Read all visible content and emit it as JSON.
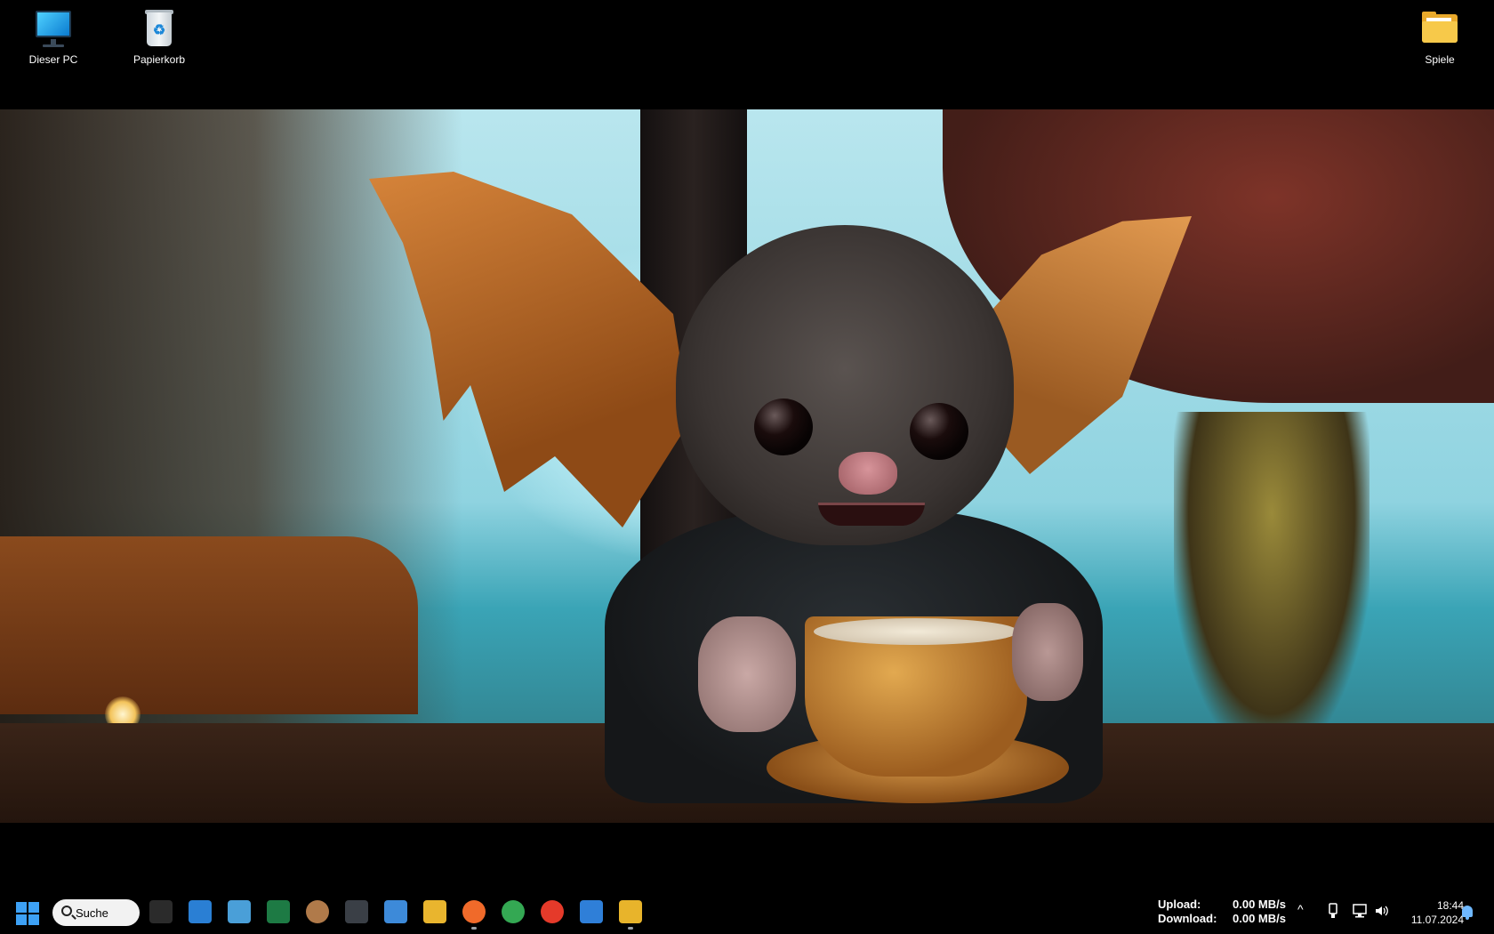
{
  "desktop": {
    "icons": [
      {
        "label": "Dieser PC",
        "icon": "monitor-icon"
      },
      {
        "label": "Papierkorb",
        "icon": "recycle-bin-icon"
      },
      {
        "label": "Spiele",
        "icon": "folder-icon"
      }
    ]
  },
  "wallpaper": {
    "subject": "bat-with-coffee-cup"
  },
  "taskbar": {
    "search_label": "Suche",
    "apps": [
      {
        "icon": "terminal-icon",
        "color": "#2b2b2b"
      },
      {
        "icon": "remote-desktop-icon",
        "color": "#2a7fd4"
      },
      {
        "icon": "image-viewer-icon",
        "color": "#4a9fd8"
      },
      {
        "icon": "excel-icon",
        "color": "#1d7a44"
      },
      {
        "icon": "app-avatar-icon",
        "color": "#b07a4a"
      },
      {
        "icon": "keyboard-icon",
        "color": "#3a3f46"
      },
      {
        "icon": "id-card-icon",
        "color": "#3d8ad9"
      },
      {
        "icon": "folder-icon",
        "color": "#e9b52e"
      },
      {
        "icon": "firefox-icon",
        "color": "#f06a2a"
      },
      {
        "icon": "chrome-icon",
        "color": "#34a853"
      },
      {
        "icon": "media-player-icon",
        "color": "#e53a2a"
      },
      {
        "icon": "window-app-icon",
        "color": "#2f7fd8"
      },
      {
        "icon": "file-explorer-icon",
        "color": "#e8b42b"
      }
    ],
    "network": {
      "upload_label": "Upload:",
      "upload_value": "0.00 MB/s",
      "download_label": "Download:",
      "download_value": "0.00 MB/s"
    },
    "tray": {
      "chevron": "^",
      "time": "18:44",
      "date": "11.07.2024"
    }
  }
}
